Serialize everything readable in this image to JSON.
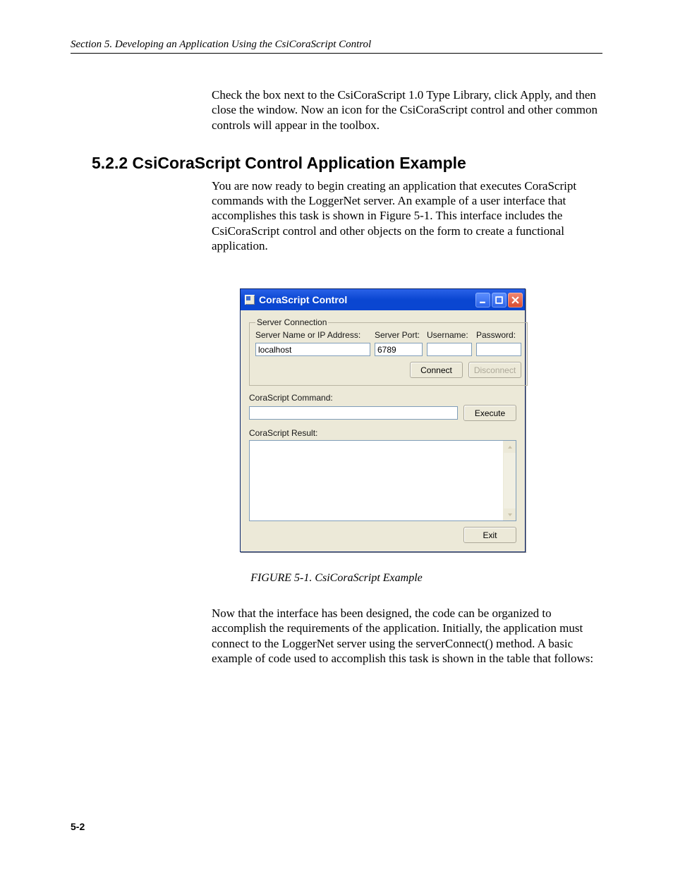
{
  "header": "Section 5.  Developing an Application Using the CsiCoraScript Control",
  "para1": "Check the box next to the CsiCoraScript 1.0 Type Library, click Apply, and then close the window.  Now an icon for the CsiCoraScript control and other common controls will appear in the toolbox.",
  "heading": "5.2.2  CsiCoraScript Control Application Example",
  "para2": "You are now ready to begin creating an application that executes CoraScript commands with the LoggerNet server.  An example of a user interface that accomplishes this task is shown in Figure 5-1.  This interface includes the CsiCoraScript control and other objects on the form to create a functional application.",
  "window": {
    "title": "CoraScript Control",
    "group_legend": "Server Connection",
    "labels": {
      "server": "Server Name or IP Address:",
      "port": "Server Port:",
      "user": "Username:",
      "pass": "Password:"
    },
    "values": {
      "server": "localhost",
      "port": "6789",
      "user": "",
      "pass": ""
    },
    "buttons": {
      "connect": "Connect",
      "disconnect": "Disconnect",
      "execute": "Execute",
      "exit": "Exit"
    },
    "cmd_label": "CoraScript Command:",
    "result_label": "CoraScript Result:"
  },
  "caption": "FIGURE 5-1.  CsiCoraScript Example",
  "para3": "Now that the interface has been designed, the code can be organized to accomplish the requirements of the application.  Initially, the application must connect to the LoggerNet server using the serverConnect() method.  A basic example of code used to accomplish this task is shown in the table that follows:",
  "pagenum": "5-2"
}
